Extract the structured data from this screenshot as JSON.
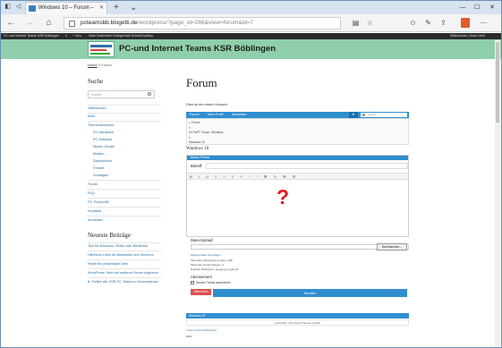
{
  "browser": {
    "tab_title": "Windows 10 – Forum –",
    "url_host": "pcteamsbb.blogetti.de",
    "url_path": "/wordpress/?page_id=266&view=forum&id=7",
    "new_tab": "+",
    "tab_menu": "⌄",
    "controls": {
      "minimize": "—",
      "maximize": "☐",
      "close": "✕"
    }
  },
  "adminbar": {
    "items": [
      "PC und Internet Teams KSR Böblingen",
      "0",
      "+ Neu",
      "Seite bearbeiten",
      "Gelegenheit-Schnell-Aufbau"
    ],
    "greeting": "Willkommen, Doris Gehl"
  },
  "site": {
    "title": "PC-und Internet Teams KSR Böblingen"
  },
  "breadcrumb": {
    "home": "Home",
    "sep": "»",
    "current": "Forum"
  },
  "sidebar": {
    "search_heading": "Suche",
    "search_placeholder": "Suche ...",
    "menu": [
      {
        "label": "Willkommen",
        "sub": false
      },
      {
        "label": "Infos",
        "sub": false
      },
      {
        "label": "Themenübersicht",
        "sub": false
      },
      {
        "label": "PC-Hardware",
        "sub": true
      },
      {
        "label": "PC-Software",
        "sub": true
      },
      {
        "label": "Mobile Geräte",
        "sub": true
      },
      {
        "label": "Medien",
        "sub": true
      },
      {
        "label": "Datenschutz",
        "sub": true
      },
      {
        "label": "Freizeit",
        "sub": true
      },
      {
        "label": "Sonstiges",
        "sub": true
      },
      {
        "label": "Forum",
        "sub": false
      },
      {
        "label": "FAQ",
        "sub": false
      },
      {
        "label": "PC-Teams BB",
        "sub": false
      },
      {
        "label": "Kontakte",
        "sub": false
      },
      {
        "label": "Anmelden",
        "sub": false
      }
    ],
    "news_heading": "Neueste Beiträge",
    "news": [
      "Tool für Windows, Setter oder Badfehler",
      "Hilfreiche Links für Mitarbeiter und Senioren",
      "Repfit für preisendale Web",
      "WordPress: Web auf anderen Server migrieren",
      "8. Treffen der KSR-PC-Teams in Deckenpfronn"
    ]
  },
  "main": {
    "title": "Forum",
    "intro": "Dies ist ein erster Versuch",
    "forum_nav": [
      "Forum",
      "Mein Profil",
      "Abmelden"
    ],
    "forum_search_placeholder": "Suche ...",
    "crumb_lines": [
      "Forum",
      "»",
      "IG-PaPT Forum: Windows",
      "»",
      "Windows 10"
    ],
    "section_title": "Windows 10",
    "editor": {
      "header": "Neues Thema",
      "subject_label": "Betreff:",
      "toolbar": "B I U ≡ ≡ ≡ ≡ “ ” ⌘ ✎ ⊞ ⊟"
    },
    "question_mark": "?",
    "upload": {
      "heading": "Datei-Upload:",
      "button": "Durchsuchen...",
      "more_link": "Weitere Datei hinzufügen",
      "max_size": "Maximale Dateigröße je Datei: 1Mb",
      "max_count": "Maximale Anzahl Dateien: 4",
      "types": "Erlaubte Dateitypen: jpg,jpeg,png,gif,pdf"
    },
    "subscribe": {
      "heading": "Abonnement",
      "checkbox_label": "Dieses Thema abonnieren",
      "cancel_button": "Abbrechen",
      "send_button": "Senden"
    },
    "footer_bar": "Windows 10",
    "footer_note": "es wurden noch keine Themen erstellt",
    "footer_link": "Forum-Feed abonnieren",
    "footer_year": "2017"
  }
}
